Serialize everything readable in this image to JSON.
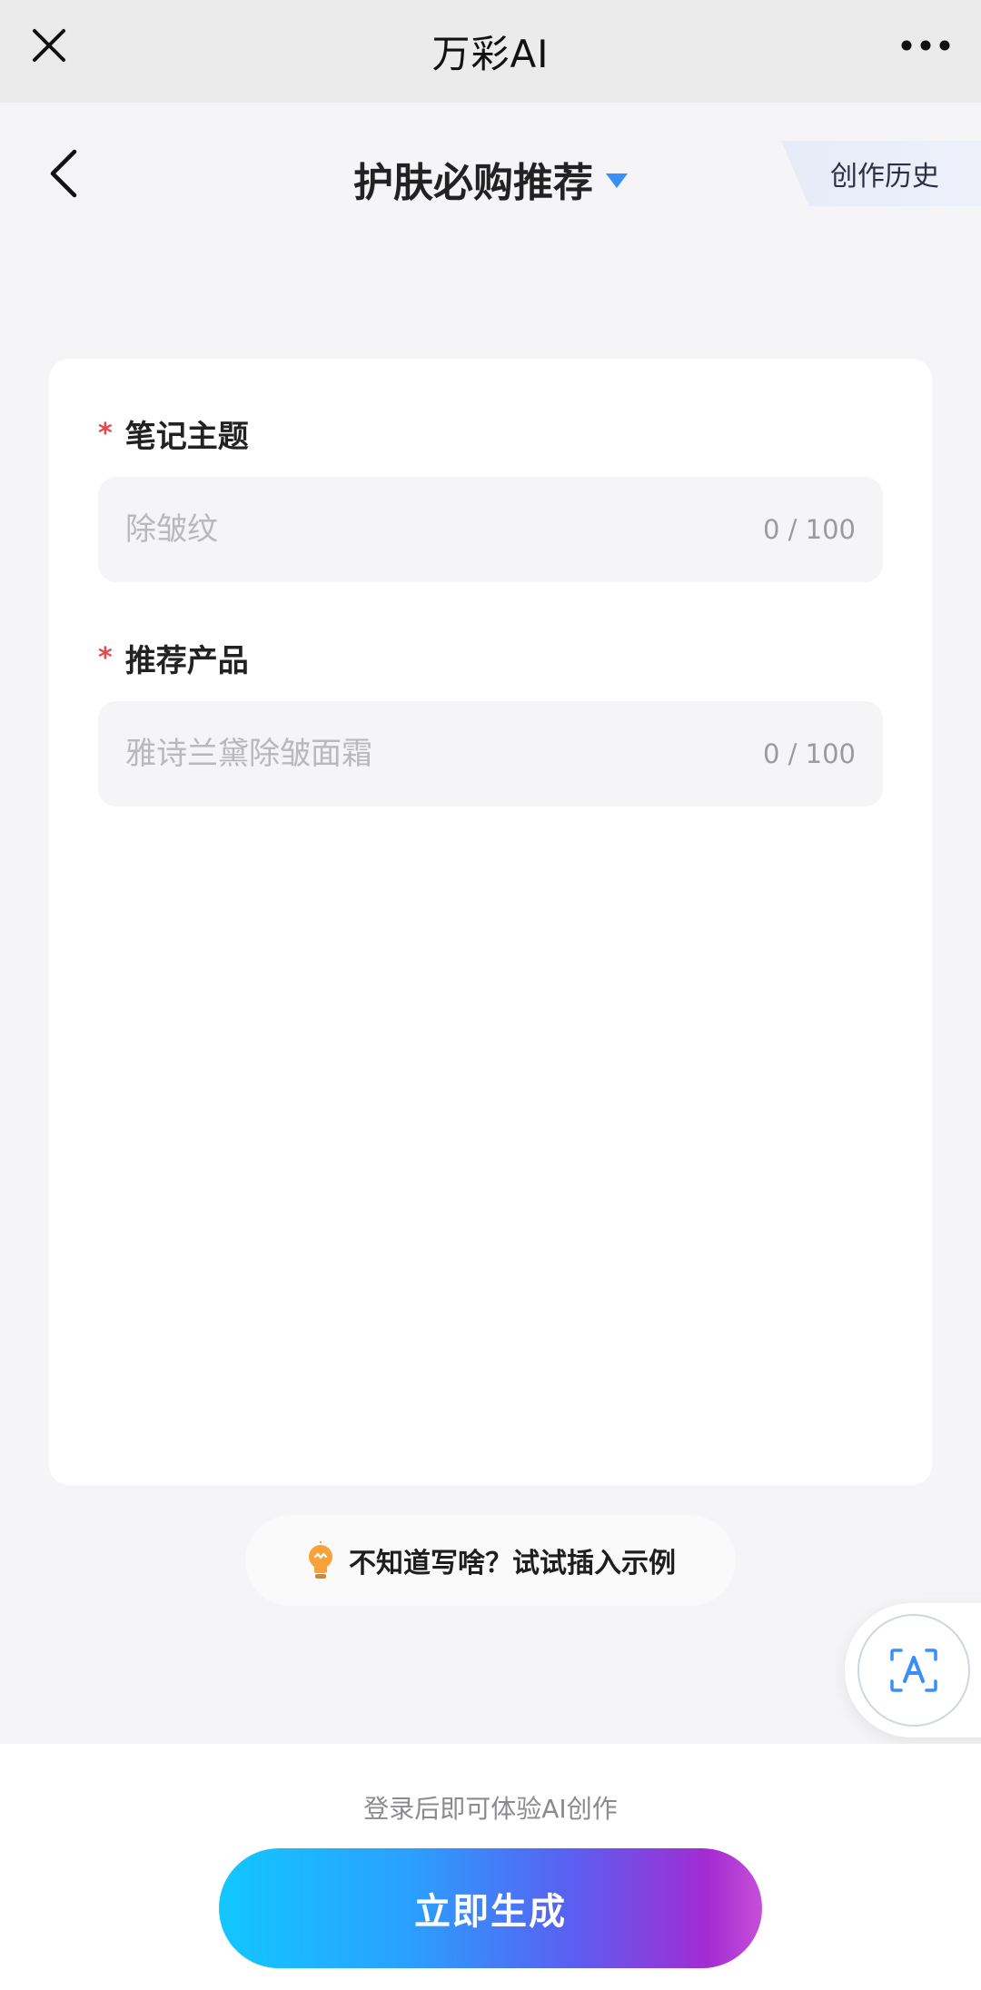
{
  "topbar": {
    "app_title": "万彩AI"
  },
  "header": {
    "page_title": "护肤必购推荐",
    "history_label": "创作历史"
  },
  "form": {
    "fields": [
      {
        "label": "笔记主题",
        "required_mark": "*",
        "placeholder": "除皱纹",
        "value": "",
        "counter": "0 / 100"
      },
      {
        "label": "推荐产品",
        "required_mark": "*",
        "placeholder": "雅诗兰黛除皱面霜",
        "value": "",
        "counter": "0 / 100"
      }
    ]
  },
  "example": {
    "text": "不知道写啥？试试插入示例",
    "icon": "lightbulb-icon"
  },
  "bottom": {
    "login_tip": "登录后即可体验AI创作",
    "generate_label": "立即生成"
  },
  "icons": {
    "close": "close-icon",
    "more": "more-dots-icon",
    "back": "back-chevron-icon",
    "dropdown": "caret-down-icon",
    "translate": "translate-icon"
  },
  "colors": {
    "accent": "#3a8ef7",
    "required": "#e5484d",
    "gradient_start": "#12c7ff",
    "gradient_end": "#c64fd8",
    "bulb": "#f7a23b"
  }
}
